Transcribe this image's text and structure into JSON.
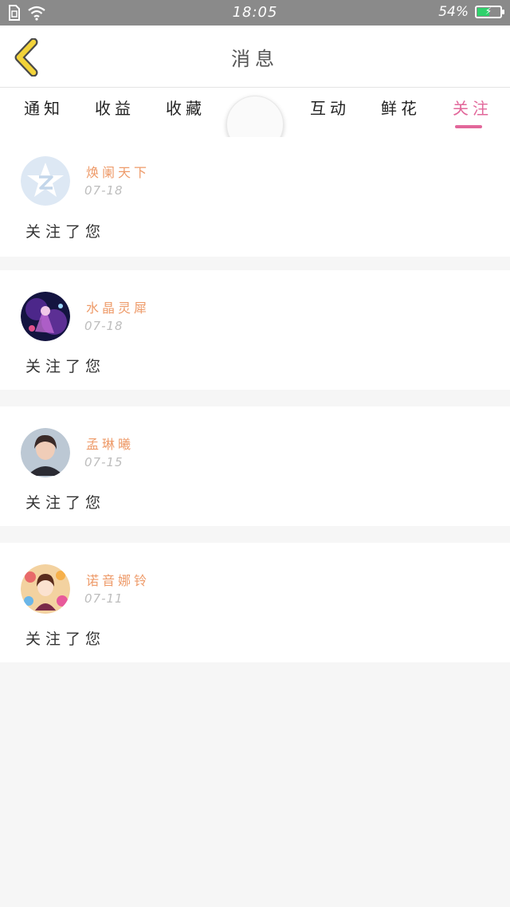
{
  "status_bar": {
    "time": "18:05",
    "battery": "54%",
    "battery_level": 0.54
  },
  "header": {
    "title": "消息"
  },
  "tabs": [
    {
      "label": "通知"
    },
    {
      "label": "收益"
    },
    {
      "label": "收藏"
    },
    {
      "label": "互动"
    },
    {
      "label": "鲜花"
    },
    {
      "label": "关注",
      "active": true
    }
  ],
  "notifications": [
    {
      "username": "焕阑天下",
      "date": "07-18",
      "message": "关注了您"
    },
    {
      "username": "水晶灵犀",
      "date": "07-18",
      "message": "关注了您"
    },
    {
      "username": "孟琳曦",
      "date": "07-15",
      "message": "关注了您"
    },
    {
      "username": "诺音娜铃",
      "date": "07-11",
      "message": "关注了您"
    }
  ],
  "colors": {
    "accent": "#e2679a",
    "username": "#ee9b6a",
    "back_arrow": "#f2d33a"
  }
}
